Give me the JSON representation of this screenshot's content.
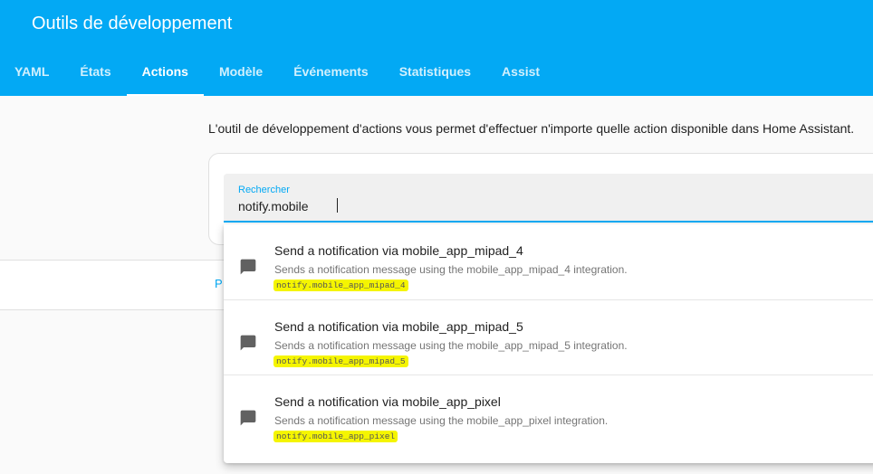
{
  "header": {
    "title": "Outils de développement",
    "tabs": [
      {
        "label": "YAML"
      },
      {
        "label": "États"
      },
      {
        "label": "Actions",
        "active": true
      },
      {
        "label": "Modèle"
      },
      {
        "label": "Événements"
      },
      {
        "label": "Statistiques"
      },
      {
        "label": "Assist"
      }
    ]
  },
  "main": {
    "intro": "L'outil de développement d'actions vous permet d'effectuer n'importe quelle action disponible dans Home Assistant.",
    "band_fragment": "P",
    "search": {
      "label": "Rechercher",
      "value": "notify.mobile"
    },
    "results": [
      {
        "title": "Send a notification via mobile_app_mipad_4",
        "description": "Sends a notification message using the mobile_app_mipad_4 integration.",
        "action_id": "notify.mobile_app_mipad_4",
        "icon": "message-icon"
      },
      {
        "title": "Send a notification via mobile_app_mipad_5",
        "description": "Sends a notification message using the mobile_app_mipad_5 integration.",
        "action_id": "notify.mobile_app_mipad_5",
        "icon": "message-icon"
      },
      {
        "title": "Send a notification via mobile_app_pixel",
        "description": "Sends a notification message using the mobile_app_pixel integration.",
        "action_id": "notify.mobile_app_pixel",
        "icon": "message-icon"
      }
    ]
  },
  "colors": {
    "accent": "#03a9f4",
    "highlight": "#f5f500",
    "background": "#fafafa"
  }
}
